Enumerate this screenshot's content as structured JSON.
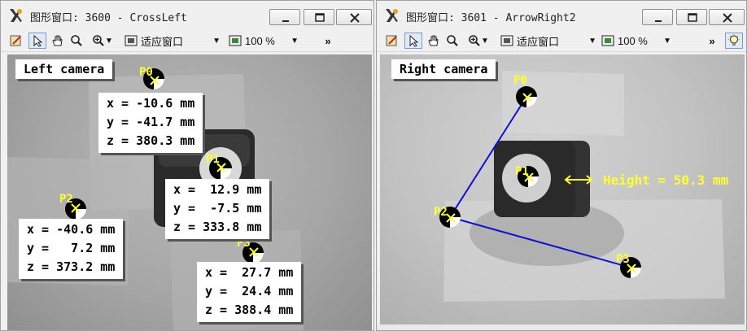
{
  "left_window": {
    "title": "图形窗口: 3600 - CrossLeft",
    "toolbar": {
      "fit_label": "适应窗口",
      "zoom_label": "100 %",
      "more": "»"
    },
    "camera_label": "Left camera",
    "points": [
      {
        "label": "P0",
        "coords": [
          "x = -10.6 mm",
          "y = -41.7 mm",
          "z = 380.3 mm"
        ]
      },
      {
        "label": "P1",
        "coords": [
          "x =  12.9 mm",
          "y =  -7.5 mm",
          "z = 333.8 mm"
        ]
      },
      {
        "label": "P2",
        "coords": [
          "x = -40.6 mm",
          "y =   7.2 mm",
          "z = 373.2 mm"
        ]
      },
      {
        "label": "P3",
        "coords": [
          "x =  27.7 mm",
          "y =  24.4 mm",
          "z = 388.4 mm"
        ]
      }
    ]
  },
  "right_window": {
    "title": "图形窗口: 3601 - ArrowRight2",
    "toolbar": {
      "fit_label": "适应窗口",
      "zoom_label": "100 %",
      "more": "»"
    },
    "camera_label": "Right camera",
    "points": [
      {
        "label": "P0"
      },
      {
        "label": "P1"
      },
      {
        "label": "P2"
      },
      {
        "label": "P3"
      }
    ],
    "height_label": "Height = 50.3 mm"
  },
  "colors": {
    "marker": "#ffff33",
    "line": "#1010d0",
    "label_bg": "#ffffff"
  }
}
